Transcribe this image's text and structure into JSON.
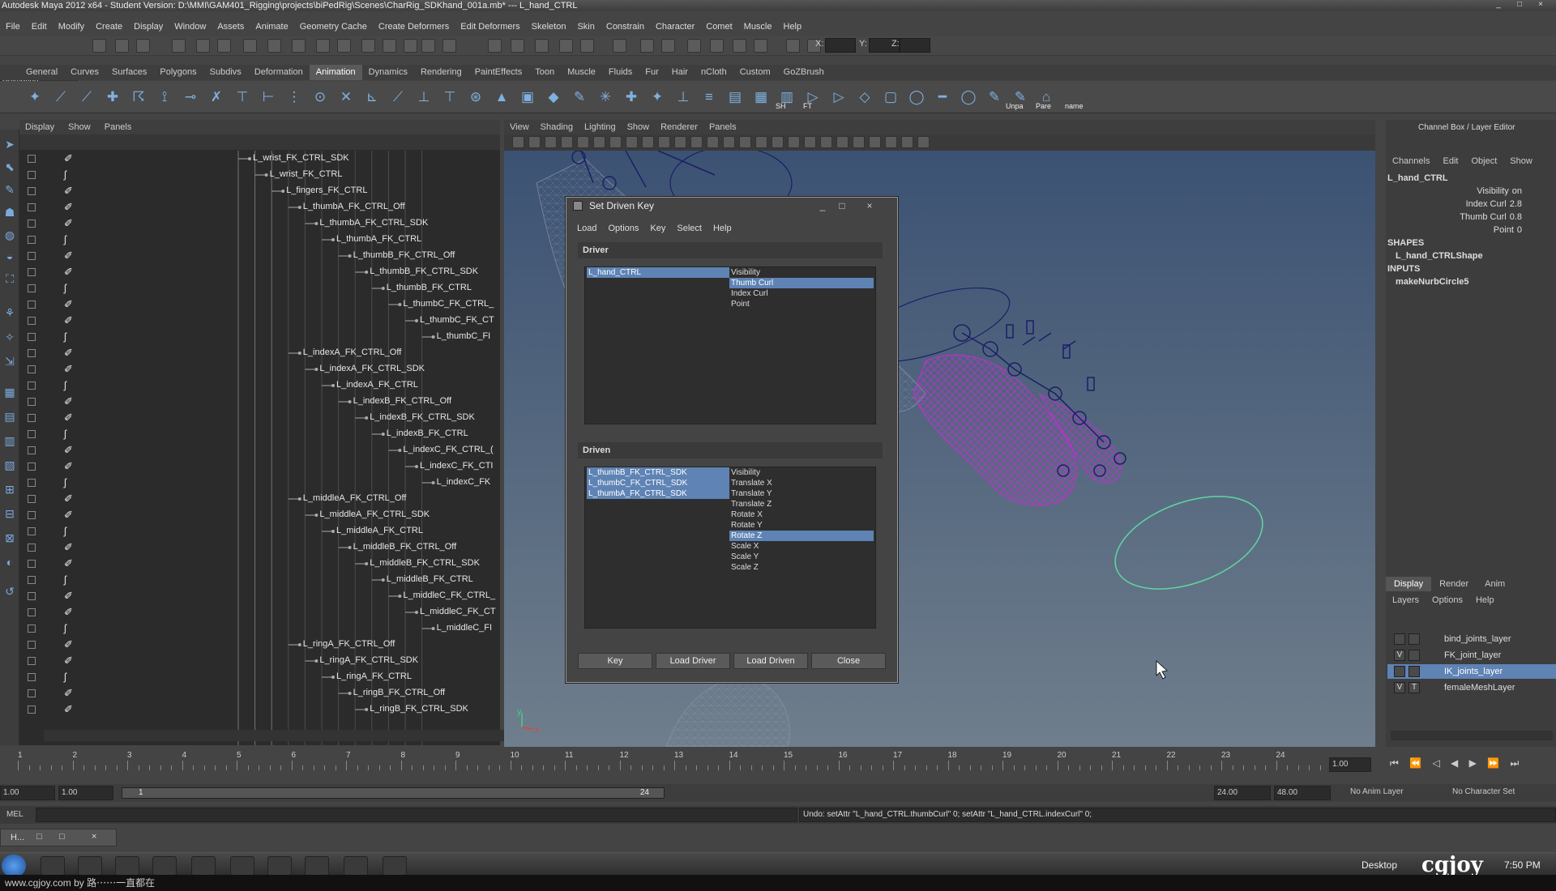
{
  "window": {
    "title": "Autodesk Maya 2012 x64 - Student Version: D:\\MMI\\GAM401_Rigging\\projects\\biPedRig\\Scenes\\CharRig_SDKhand_001a.mb*   ---   L_hand_CTRL",
    "controls": [
      "_",
      "□",
      "×"
    ]
  },
  "menubar": [
    "File",
    "Edit",
    "Modify",
    "Create",
    "Display",
    "Window",
    "Assets",
    "Animate",
    "Geometry Cache",
    "Create Deformers",
    "Edit Deformers",
    "Skeleton",
    "Skin",
    "Constrain",
    "Character",
    "Comet",
    "Muscle",
    "Help"
  ],
  "toolbar": {
    "mode": "Animation",
    "x_label": "X:",
    "y_label": "Y:",
    "z_label": "Z:"
  },
  "shelf_tabs": [
    "General",
    "Curves",
    "Surfaces",
    "Polygons",
    "Subdivs",
    "Deformation",
    "Animation",
    "Dynamics",
    "Rendering",
    "PaintEffects",
    "Toon",
    "Muscle",
    "Fluids",
    "Fur",
    "Hair",
    "nCloth",
    "Custom",
    "GoZBrush"
  ],
  "shelf_active": "Animation",
  "shelf_labels": [
    "SH",
    "FT",
    "Unpa",
    "Pare",
    "name"
  ],
  "outliner": {
    "menu": [
      "Display",
      "Show",
      "Panels"
    ],
    "rows": [
      {
        "label": "L_wrist_FK_CTRL_SDK",
        "indent": 0,
        "icon": "joint"
      },
      {
        "label": "L_wrist_FK_CTRL",
        "indent": 1,
        "icon": "curve"
      },
      {
        "label": "L_fingers_FK_CTRL",
        "indent": 2,
        "icon": "joint"
      },
      {
        "label": "L_thumbA_FK_CTRL_Off",
        "indent": 3,
        "icon": "joint"
      },
      {
        "label": "L_thumbA_FK_CTRL_SDK",
        "indent": 4,
        "icon": "joint"
      },
      {
        "label": "L_thumbA_FK_CTRL",
        "indent": 5,
        "icon": "curve"
      },
      {
        "label": "L_thumbB_FK_CTRL_Off",
        "indent": 6,
        "icon": "joint"
      },
      {
        "label": "L_thumbB_FK_CTRL_SDK",
        "indent": 7,
        "icon": "joint"
      },
      {
        "label": "L_thumbB_FK_CTRL",
        "indent": 8,
        "icon": "curve"
      },
      {
        "label": "L_thumbC_FK_CTRL_",
        "indent": 9,
        "icon": "joint"
      },
      {
        "label": "L_thumbC_FK_CT",
        "indent": 10,
        "icon": "joint"
      },
      {
        "label": "L_thumbC_FI",
        "indent": 11,
        "icon": "curve"
      },
      {
        "label": "L_indexA_FK_CTRL_Off",
        "indent": 3,
        "icon": "joint"
      },
      {
        "label": "L_indexA_FK_CTRL_SDK",
        "indent": 4,
        "icon": "joint"
      },
      {
        "label": "L_indexA_FK_CTRL",
        "indent": 5,
        "icon": "curve"
      },
      {
        "label": "L_indexB_FK_CTRL_Off",
        "indent": 6,
        "icon": "joint"
      },
      {
        "label": "L_indexB_FK_CTRL_SDK",
        "indent": 7,
        "icon": "joint"
      },
      {
        "label": "L_indexB_FK_CTRL",
        "indent": 8,
        "icon": "curve"
      },
      {
        "label": "L_indexC_FK_CTRL_(",
        "indent": 9,
        "icon": "joint"
      },
      {
        "label": "L_indexC_FK_CTI",
        "indent": 10,
        "icon": "joint"
      },
      {
        "label": "L_indexC_FK",
        "indent": 11,
        "icon": "curve"
      },
      {
        "label": "L_middleA_FK_CTRL_Off",
        "indent": 3,
        "icon": "joint"
      },
      {
        "label": "L_middleA_FK_CTRL_SDK",
        "indent": 4,
        "icon": "joint"
      },
      {
        "label": "L_middleA_FK_CTRL",
        "indent": 5,
        "icon": "curve"
      },
      {
        "label": "L_middleB_FK_CTRL_Off",
        "indent": 6,
        "icon": "joint"
      },
      {
        "label": "L_middleB_FK_CTRL_SDK",
        "indent": 7,
        "icon": "joint"
      },
      {
        "label": "L_middleB_FK_CTRL",
        "indent": 8,
        "icon": "curve"
      },
      {
        "label": "L_middleC_FK_CTRL_",
        "indent": 9,
        "icon": "joint"
      },
      {
        "label": "L_middleC_FK_CT",
        "indent": 10,
        "icon": "joint"
      },
      {
        "label": "L_middleC_FI",
        "indent": 11,
        "icon": "curve"
      },
      {
        "label": "L_ringA_FK_CTRL_Off",
        "indent": 3,
        "icon": "joint"
      },
      {
        "label": "L_ringA_FK_CTRL_SDK",
        "indent": 4,
        "icon": "joint"
      },
      {
        "label": "L_ringA_FK_CTRL",
        "indent": 5,
        "icon": "curve"
      },
      {
        "label": "L_ringB_FK_CTRL_Off",
        "indent": 6,
        "icon": "joint"
      },
      {
        "label": "L_ringB_FK_CTRL_SDK",
        "indent": 7,
        "icon": "joint"
      }
    ]
  },
  "viewport": {
    "menu": [
      "View",
      "Shading",
      "Lighting",
      "Show",
      "Renderer",
      "Panels"
    ],
    "axis_x": "x",
    "axis_y": "y"
  },
  "dialog": {
    "title": "Set Driven Key",
    "menu": [
      "Load",
      "Options",
      "Key",
      "Select",
      "Help"
    ],
    "driver_label": "Driver",
    "driver_objects": [
      {
        "name": "L_hand_CTRL",
        "selected": true
      }
    ],
    "driver_attrs": [
      {
        "name": "Visibility",
        "selected": false
      },
      {
        "name": "Thumb Curl",
        "selected": true
      },
      {
        "name": "Index Curl",
        "selected": false
      },
      {
        "name": "Point",
        "selected": false
      }
    ],
    "driven_label": "Driven",
    "driven_objects": [
      {
        "name": "L_thumbB_FK_CTRL_SDK",
        "selected": true
      },
      {
        "name": "L_thumbC_FK_CTRL_SDK",
        "selected": true
      },
      {
        "name": "L_thumbA_FK_CTRL_SDK",
        "selected": true
      }
    ],
    "driven_attrs": [
      {
        "name": "Visibility",
        "selected": false
      },
      {
        "name": "Translate X",
        "selected": false
      },
      {
        "name": "Translate Y",
        "selected": false
      },
      {
        "name": "Translate Z",
        "selected": false
      },
      {
        "name": "Rotate X",
        "selected": false
      },
      {
        "name": "Rotate Y",
        "selected": false
      },
      {
        "name": "Rotate Z",
        "selected": true
      },
      {
        "name": "Scale X",
        "selected": false
      },
      {
        "name": "Scale Y",
        "selected": false
      },
      {
        "name": "Scale Z",
        "selected": false
      }
    ],
    "buttons": {
      "key": "Key",
      "load_driver": "Load Driver",
      "load_driven": "Load Driven",
      "close": "Close"
    }
  },
  "channel_box": {
    "title": "Channel Box / Layer Editor",
    "menu": [
      "Channels",
      "Edit",
      "Object",
      "Show"
    ],
    "object": "L_hand_CTRL",
    "channels": [
      {
        "name": "Visibility",
        "value": "on"
      },
      {
        "name": "Index Curl",
        "value": "2.8"
      },
      {
        "name": "Thumb Curl",
        "value": "0.8"
      },
      {
        "name": "Point",
        "value": "0"
      }
    ],
    "shapes_label": "SHAPES",
    "shape": "L_hand_CTRLShape",
    "inputs_label": "INPUTS",
    "input": "makeNurbCircle5"
  },
  "layer_editor": {
    "tabs": [
      "Display",
      "Render",
      "Anim"
    ],
    "menu": [
      "Layers",
      "Options",
      "Help"
    ],
    "layers": [
      {
        "name": "bind_joints_layer",
        "v": "",
        "t": "",
        "selected": false
      },
      {
        "name": "FK_joint_layer",
        "v": "V",
        "t": "",
        "selected": false
      },
      {
        "name": "IK_joints_layer",
        "v": "",
        "t": "",
        "selected": true
      },
      {
        "name": "femaleMeshLayer",
        "v": "V",
        "t": "T",
        "selected": false
      }
    ]
  },
  "timeline": {
    "ticks": [
      1,
      2,
      3,
      4,
      5,
      6,
      7,
      8,
      9,
      10,
      11,
      12,
      13,
      14,
      15,
      16,
      17,
      18,
      19,
      20,
      21,
      22,
      23,
      24
    ],
    "current_frame": "1.00"
  },
  "range": {
    "start": "1.00",
    "start2": "1.00",
    "slider_start": "1",
    "slider_end": "24",
    "end": "24.00",
    "end2": "48.00",
    "anim_layer": "No Anim Layer",
    "character": "No Character Set"
  },
  "command": {
    "label": "MEL",
    "result": "Undo: setAttr \"L_hand_CTRL.thumbCurl\" 0; setAttr \"L_hand_CTRL.indexCurl\" 0;"
  },
  "minimized": {
    "label": "H..."
  },
  "taskbar": {
    "desktop": "Desktop",
    "time": "7:50 PM",
    "logo": "cgjoy"
  },
  "watermark": "www.cgjoy.com by 路⋯⋯一直都在",
  "colors": {
    "selection": "#5e83b4",
    "viewport_top": "#3c5273",
    "wire_magenta": "#c030d0",
    "wire_green": "#5fd6a0",
    "wire_navy": "#1b1f66"
  }
}
